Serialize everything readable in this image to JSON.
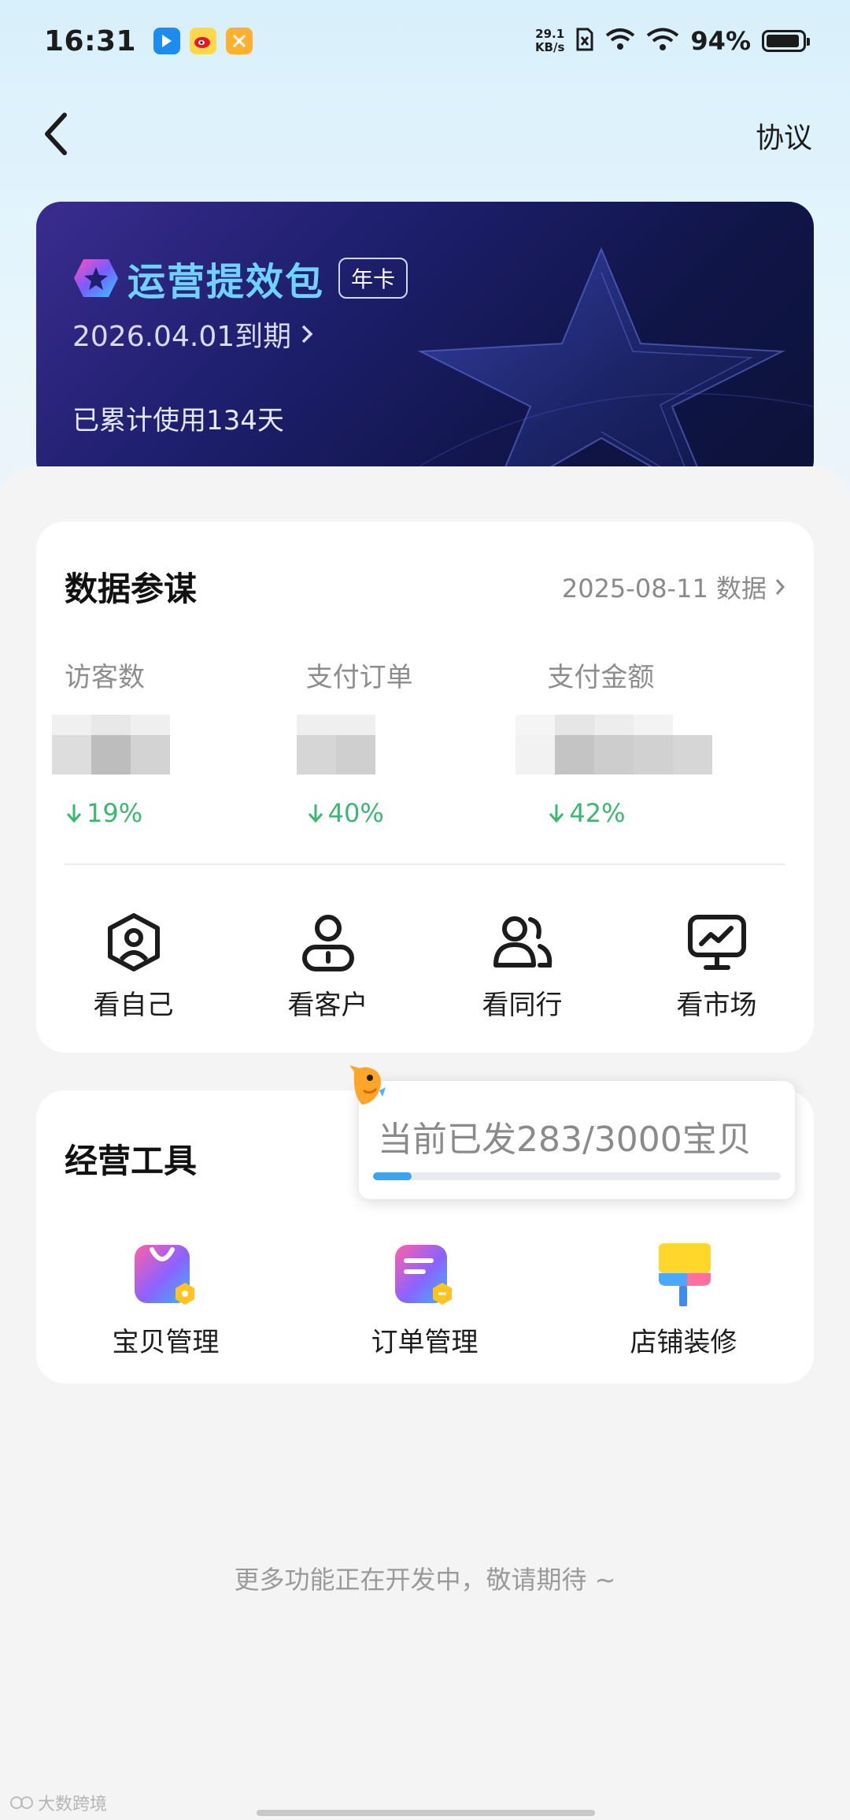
{
  "status_bar": {
    "time": "16:31",
    "net_speed_value": "29.1",
    "net_speed_unit": "KB/s",
    "battery": "94%",
    "battery_level": 0.94
  },
  "nav": {
    "back_icon": "chevron-left-icon",
    "right_link": "协议"
  },
  "banner": {
    "title": "运营提效包",
    "tag": "年卡",
    "expire": "2026.04.01到期",
    "used": "已累计使用134天",
    "accent": "#6fd2ff"
  },
  "data_card": {
    "title": "数据参谋",
    "date_link": "2025-08-11 数据",
    "metrics": [
      {
        "label": "访客数",
        "change": "19%",
        "direction": "down"
      },
      {
        "label": "支付订单",
        "change": "40%",
        "direction": "down"
      },
      {
        "label": "支付金额",
        "change": "42%",
        "direction": "down"
      }
    ],
    "quick_links": [
      {
        "label": "看自己",
        "icon": "user-shield-icon"
      },
      {
        "label": "看客户",
        "icon": "customer-icon"
      },
      {
        "label": "看同行",
        "icon": "peers-icon"
      },
      {
        "label": "看市场",
        "icon": "market-chart-icon"
      }
    ]
  },
  "tools_card": {
    "title": "经营工具",
    "tools": [
      {
        "label": "宝贝管理",
        "icon": "product-bag-icon"
      },
      {
        "label": "订单管理",
        "icon": "order-doc-icon"
      },
      {
        "label": "店铺装修",
        "icon": "paint-brush-icon"
      }
    ]
  },
  "tooltip": {
    "text": "当前已发283/3000宝贝",
    "progress": 0.0943
  },
  "footer": {
    "note": "更多功能正在开发中，敬请期待 ~"
  },
  "watermark": {
    "text": "大数跨境"
  },
  "colors": {
    "positive_green": "#3ab870",
    "progress_blue": "#3aa4ec"
  }
}
